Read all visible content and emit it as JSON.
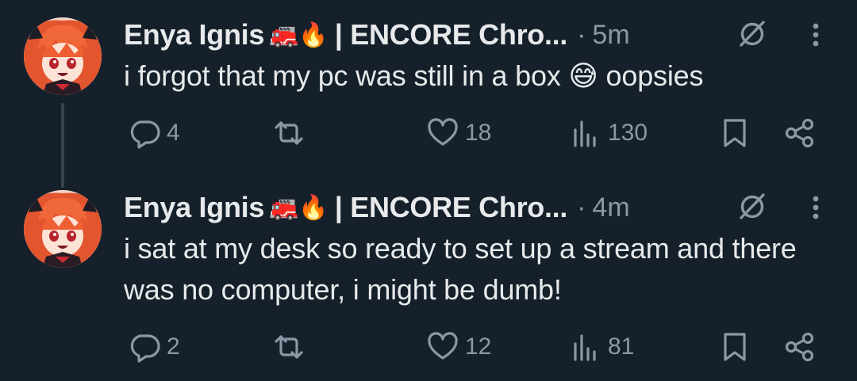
{
  "tweets": [
    {
      "display_name": "Enya Ignis",
      "name_emojis": "🚒🔥",
      "name_suffix": "| ENCORE Chro...",
      "separator": "·",
      "time": "5m",
      "text": "i forgot that my pc was still in a box 😅 oopsies",
      "replies": "4",
      "retweets": "",
      "likes": "18",
      "views": "130"
    },
    {
      "display_name": "Enya Ignis",
      "name_emojis": "🚒🔥",
      "name_suffix": "| ENCORE Chro...",
      "separator": "·",
      "time": "4m",
      "text": "i sat at my desk so ready to set up a stream and there was no computer, i might be dumb!",
      "replies": "2",
      "retweets": "",
      "likes": "12",
      "views": "81"
    }
  ],
  "icons": {
    "reply": "reply-icon",
    "retweet": "retweet-icon",
    "like": "heart-icon",
    "views": "views-icon",
    "bookmark": "bookmark-icon",
    "share": "share-icon",
    "grok": "grok-icon",
    "more": "more-icon"
  },
  "colors": {
    "background": "#15202b",
    "text": "#e7e9ea",
    "secondary": "#8b98a5",
    "thread_line": "#38444d"
  }
}
